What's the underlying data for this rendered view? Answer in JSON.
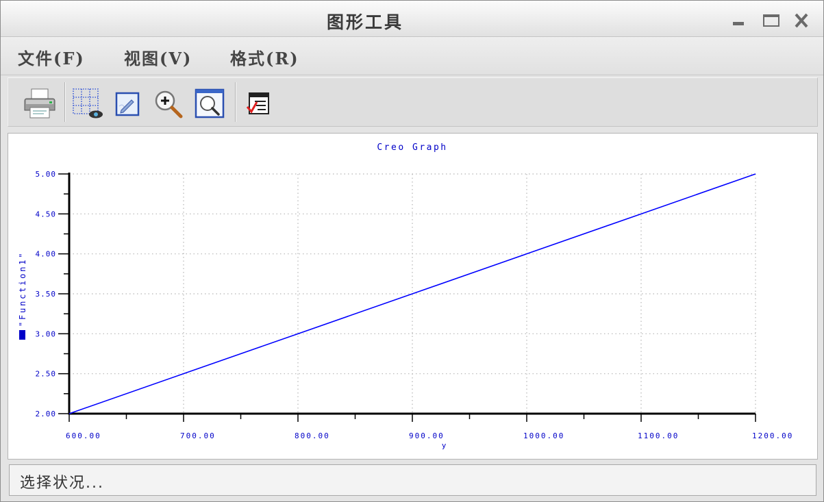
{
  "window": {
    "title": "图形工具",
    "controls": {
      "minimize": "minimize-icon",
      "maximize": "maximize-icon",
      "close": "close-icon"
    }
  },
  "menu": {
    "items": [
      {
        "label": "文件(F)"
      },
      {
        "label": "视图(V)"
      },
      {
        "label": "格式(R)"
      }
    ]
  },
  "toolbar": {
    "buttons": [
      {
        "icon": "printer-icon"
      },
      {
        "icon": "grid-select-icon"
      },
      {
        "icon": "edit-format-icon"
      },
      {
        "icon": "zoom-in-icon"
      },
      {
        "icon": "zoom-window-icon"
      },
      {
        "icon": "checklist-icon"
      }
    ]
  },
  "colors": {
    "series": "#0000ff",
    "chart_text": "#0000c8",
    "axis": "#000000",
    "grid": "#b4b4b4",
    "legend_swatch": "#0000c8"
  },
  "chart_data": {
    "type": "line",
    "title": "Creo Graph",
    "xlabel": "y",
    "ylabel": "\"Function1\"",
    "xlim": [
      600,
      1200
    ],
    "ylim": [
      2,
      5
    ],
    "grid": true,
    "x_ticks": [
      {
        "value": 600,
        "label": "600.00"
      },
      {
        "value": 700,
        "label": "700.00"
      },
      {
        "value": 800,
        "label": "800.00"
      },
      {
        "value": 900,
        "label": "900.00"
      },
      {
        "value": 1000,
        "label": "1000.00"
      },
      {
        "value": 1100,
        "label": "1100.00"
      },
      {
        "value": 1200,
        "label": "1200.00"
      }
    ],
    "y_ticks": [
      {
        "value": 5,
        "label": "5.00"
      },
      {
        "value": 4.5,
        "label": "4.50"
      },
      {
        "value": 4,
        "label": "4.00"
      },
      {
        "value": 3.5,
        "label": "3.50"
      },
      {
        "value": 3,
        "label": "3.00"
      },
      {
        "value": 2.5,
        "label": "2.50"
      },
      {
        "value": 2,
        "label": "2.00"
      }
    ],
    "series": [
      {
        "color": "#0000ff",
        "x": [
          600,
          700,
          800,
          900,
          1000,
          1100,
          1200
        ],
        "y": [
          2,
          2.5,
          3,
          3.5,
          4,
          4.5,
          5
        ]
      }
    ]
  },
  "status": {
    "text": "选择状况..."
  }
}
